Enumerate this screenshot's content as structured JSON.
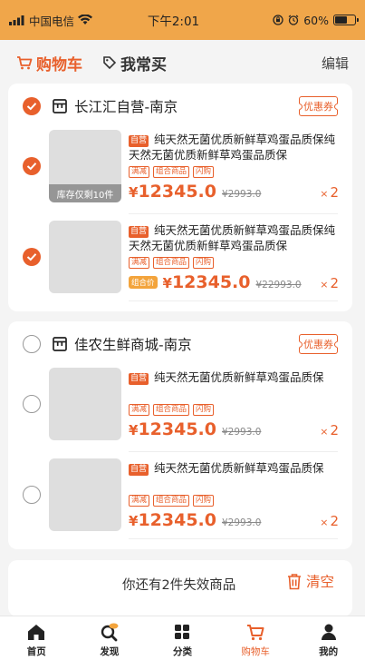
{
  "status_bar": {
    "carrier": "中国电信",
    "time": "下午2:01",
    "battery": "60%",
    "battery_level": 0.6
  },
  "header": {
    "tabs": [
      {
        "label": "购物车",
        "active": true
      },
      {
        "label": "我常买",
        "active": false
      }
    ],
    "edit_label": "编辑"
  },
  "stores": [
    {
      "name": "长江汇自营-南京",
      "checked": true,
      "coupon_label": "优惠券",
      "items": [
        {
          "checked": true,
          "self_tag": "自营",
          "title": "纯天然无菌优质新鲜草鸡蛋品质保纯天然无菌优质新鲜草鸡蛋品质保",
          "tags": [
            "满减",
            "组合商品",
            "闪购"
          ],
          "stock_note": "库存仅剩10件",
          "price_yen": "¥",
          "price": "12345.0",
          "original_price": "¥2993.0",
          "qty_x": "×",
          "qty": "2"
        },
        {
          "checked": true,
          "self_tag": "自营",
          "title": "纯天然无菌优质新鲜草鸡蛋品质保纯天然无菌优质新鲜草鸡蛋品质保",
          "tags": [
            "满减",
            "组合商品",
            "闪购"
          ],
          "group_price_label": "组合价",
          "price_yen": "¥",
          "price": "12345.0",
          "original_price": "¥22993.0",
          "qty_x": "×",
          "qty": "2"
        }
      ]
    },
    {
      "name": "佳农生鲜商城-南京",
      "checked": false,
      "coupon_label": "优惠券",
      "items": [
        {
          "checked": false,
          "self_tag": "自营",
          "title": "纯天然无菌优质新鲜草鸡蛋品质保",
          "tags": [
            "满减",
            "组合商品",
            "闪购"
          ],
          "price_yen": "¥",
          "price": "12345.0",
          "original_price": "¥2993.0",
          "qty_x": "×",
          "qty": "2"
        },
        {
          "checked": false,
          "self_tag": "自营",
          "title": "纯天然无菌优质新鲜草鸡蛋品质保",
          "tags": [
            "满减",
            "组合商品",
            "闪购"
          ],
          "price_yen": "¥",
          "price": "12345.0",
          "original_price": "¥2993.0",
          "qty_x": "×",
          "qty": "2"
        }
      ]
    }
  ],
  "invalid": {
    "text": "你还有2件失效商品",
    "clear_label": "清空"
  },
  "tabbar": [
    {
      "label": "首页",
      "icon": "home-icon"
    },
    {
      "label": "发现",
      "icon": "discover-icon"
    },
    {
      "label": "分类",
      "icon": "category-icon"
    },
    {
      "label": "购物车",
      "icon": "cart-icon",
      "active": true
    },
    {
      "label": "我的",
      "icon": "profile-icon"
    }
  ],
  "colors": {
    "accent": "#e8602c",
    "status_bar": "#f0a64a",
    "group_price": "#f3a43c"
  }
}
